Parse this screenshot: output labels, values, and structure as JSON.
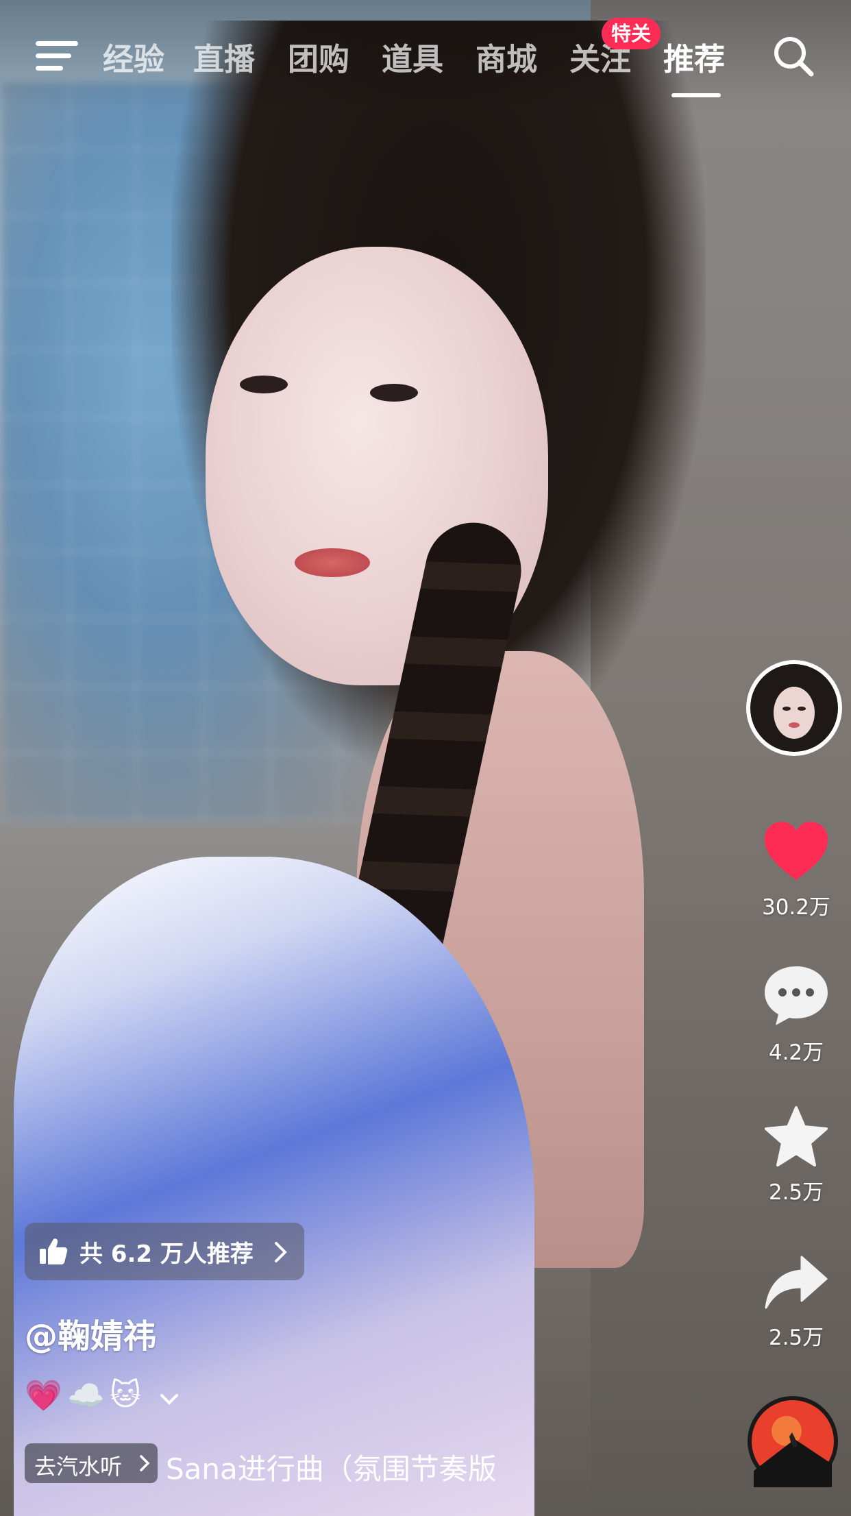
{
  "top_nav": {
    "tabs": [
      {
        "label": "经验"
      },
      {
        "label": "直播"
      },
      {
        "label": "团购"
      },
      {
        "label": "道具"
      },
      {
        "label": "商城"
      },
      {
        "label": "关注"
      },
      {
        "label": "推荐"
      }
    ],
    "active_tab": "推荐",
    "follow_badge": "特关",
    "menu_icon": "hamburger-menu-icon",
    "search_icon": "search-icon"
  },
  "right_rail": {
    "avatar_icon": "creator-avatar",
    "like_count": "30.2万",
    "comment_count": "4.2万",
    "favorite_count": "2.5万",
    "share_count": "2.5万",
    "like_color": "#fe2c55"
  },
  "video_info": {
    "recommend_label": "共 6.2 万人推荐",
    "author": "@鞠婧祎",
    "description_emojis": [
      "💗",
      "☁️",
      "🐱"
    ],
    "music_tag": "去汽水听",
    "music_title": "Sana进行曲（氛围节奏版"
  }
}
